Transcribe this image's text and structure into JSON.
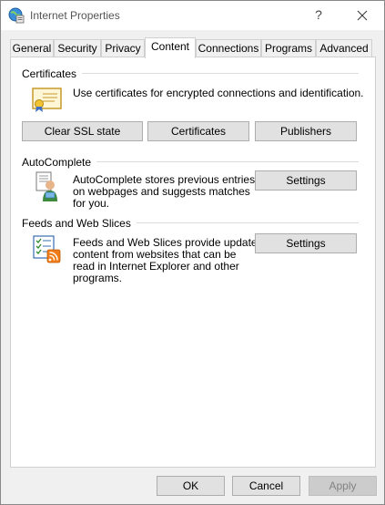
{
  "window": {
    "title": "Internet Properties",
    "help_label": "?",
    "close_label": "✕"
  },
  "tabs": [
    {
      "label": "General"
    },
    {
      "label": "Security"
    },
    {
      "label": "Privacy"
    },
    {
      "label": "Content",
      "active": true
    },
    {
      "label": "Connections"
    },
    {
      "label": "Programs"
    },
    {
      "label": "Advanced"
    }
  ],
  "certificates": {
    "title": "Certificates",
    "description": "Use certificates for encrypted connections and identification.",
    "clear_ssl_label": "Clear SSL state",
    "certificates_label": "Certificates",
    "publishers_label": "Publishers",
    "icon": "certificate-icon"
  },
  "autocomplete": {
    "title": "AutoComplete",
    "description_lines": [
      "AutoComplete stores previous entries",
      "on webpages and suggests matches",
      "for you."
    ],
    "settings_label": "Settings",
    "icon": "autocomplete-icon"
  },
  "feeds": {
    "title": "Feeds and Web Slices",
    "description_lines": [
      "Feeds and Web Slices provide updated",
      "content from websites that can be",
      "read in Internet Explorer and other",
      "programs."
    ],
    "settings_label": "Settings",
    "icon": "feeds-icon"
  },
  "footer": {
    "ok_label": "OK",
    "cancel_label": "Cancel",
    "apply_label": "Apply"
  }
}
